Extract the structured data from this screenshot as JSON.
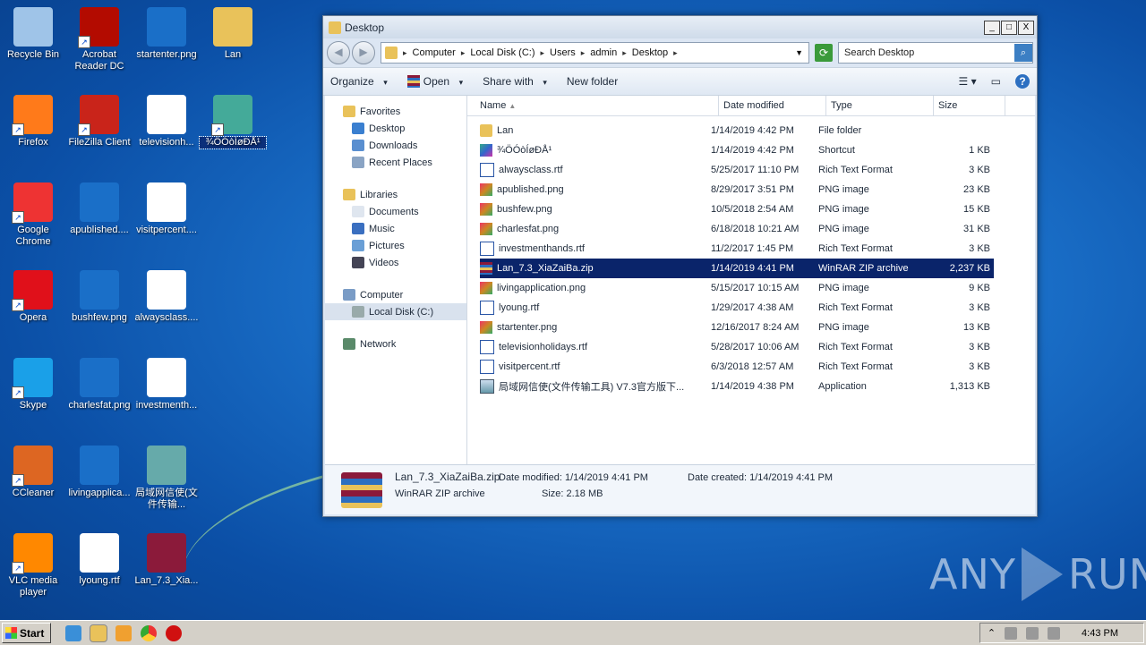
{
  "desktop": {
    "icons": [
      {
        "label": "Recycle Bin",
        "icon": "recycle-bin-icon",
        "color": "#9fc4e8"
      },
      {
        "label": "Acrobat Reader DC",
        "icon": "acrobat-icon",
        "color": "#b30b00"
      },
      {
        "label": "startenter.png",
        "icon": "png-file-icon",
        "color": "#1a6fc8"
      },
      {
        "label": "Lan",
        "icon": "folder-icon",
        "color": "#e9c25a"
      },
      {
        "label": "Firefox",
        "icon": "firefox-icon",
        "color": "#ff7a1a"
      },
      {
        "label": "FileZilla Client",
        "icon": "filezilla-icon",
        "color": "#c9241a"
      },
      {
        "label": "televisionh...",
        "icon": "word-doc-icon",
        "color": "#ffffff"
      },
      {
        "label": "¾ÖÓòÍøÐÅ¹",
        "icon": "shortcut-app-icon",
        "color": "#4a9"
      },
      {
        "label": "Google Chrome",
        "icon": "chrome-icon",
        "color": "#e33"
      },
      {
        "label": "apublished....",
        "icon": "png-file-icon",
        "color": "#1a6fc8"
      },
      {
        "label": "visitpercent....",
        "icon": "word-doc-icon",
        "color": "#ffffff"
      },
      {
        "label": "Opera",
        "icon": "opera-icon",
        "color": "#e0101a"
      },
      {
        "label": "bushfew.png",
        "icon": "png-file-icon",
        "color": "#1a6fc8"
      },
      {
        "label": "alwaysclass....",
        "icon": "word-doc-icon",
        "color": "#ffffff"
      },
      {
        "label": "Skype",
        "icon": "skype-icon",
        "color": "#1aa0e8"
      },
      {
        "label": "charlesfat.png",
        "icon": "png-file-icon",
        "color": "#1a6fc8"
      },
      {
        "label": "investmenth...",
        "icon": "word-doc-icon",
        "color": "#ffffff"
      },
      {
        "label": "CCleaner",
        "icon": "ccleaner-icon",
        "color": "#d62"
      },
      {
        "label": "livingapplica...",
        "icon": "png-file-icon",
        "color": "#1a6fc8"
      },
      {
        "label": "局域网信使(文件传输...",
        "icon": "installer-icon",
        "color": "#6aa"
      },
      {
        "label": "VLC media player",
        "icon": "vlc-icon",
        "color": "#f80"
      },
      {
        "label": "lyoung.rtf",
        "icon": "word-doc-icon",
        "color": "#ffffff"
      },
      {
        "label": "Lan_7.3_Xia...",
        "icon": "winrar-icon",
        "color": "#8b1a3a"
      }
    ]
  },
  "explorer": {
    "title": "Desktop",
    "title_buttons": [
      "_",
      "□",
      "X"
    ],
    "breadcrumb": [
      "Computer",
      "Local Disk (C:)",
      "Users",
      "admin",
      "Desktop"
    ],
    "search_placeholder": "Search Desktop",
    "toolbar": {
      "organize": "Organize",
      "open": "Open",
      "share": "Share with",
      "new_folder": "New folder"
    },
    "nav": {
      "favorites": "Favorites",
      "fav_items": [
        "Desktop",
        "Downloads",
        "Recent Places"
      ],
      "libraries": "Libraries",
      "lib_items": [
        "Documents",
        "Music",
        "Pictures",
        "Videos"
      ],
      "computer": "Computer",
      "local_disk": "Local Disk (C:)",
      "network": "Network"
    },
    "columns": [
      "Name",
      "Date modified",
      "Type",
      "Size"
    ],
    "files": [
      {
        "name": "Lan",
        "date": "1/14/2019 4:42 PM",
        "type": "File folder",
        "size": "",
        "icon": "i-folder"
      },
      {
        "name": "¾ÖÓòÍøÐÅ¹",
        "date": "1/14/2019 4:42 PM",
        "type": "Shortcut",
        "size": "1 KB",
        "icon": "i-shortcut"
      },
      {
        "name": "alwaysclass.rtf",
        "date": "5/25/2017 11:10 PM",
        "type": "Rich Text Format",
        "size": "3 KB",
        "icon": "i-rtf"
      },
      {
        "name": "apublished.png",
        "date": "8/29/2017 3:51 PM",
        "type": "PNG image",
        "size": "23 KB",
        "icon": "i-png"
      },
      {
        "name": "bushfew.png",
        "date": "10/5/2018 2:54 AM",
        "type": "PNG image",
        "size": "15 KB",
        "icon": "i-png"
      },
      {
        "name": "charlesfat.png",
        "date": "6/18/2018 10:21 AM",
        "type": "PNG image",
        "size": "31 KB",
        "icon": "i-png"
      },
      {
        "name": "investmenthands.rtf",
        "date": "11/2/2017 1:45 PM",
        "type": "Rich Text Format",
        "size": "3 KB",
        "icon": "i-rtf"
      },
      {
        "name": "Lan_7.3_XiaZaiBa.zip",
        "date": "1/14/2019 4:41 PM",
        "type": "WinRAR ZIP archive",
        "size": "2,237 KB",
        "icon": "i-zip",
        "selected": true
      },
      {
        "name": "livingapplication.png",
        "date": "5/15/2017 10:15 AM",
        "type": "PNG image",
        "size": "9 KB",
        "icon": "i-png"
      },
      {
        "name": "lyoung.rtf",
        "date": "1/29/2017 4:38 AM",
        "type": "Rich Text Format",
        "size": "3 KB",
        "icon": "i-rtf"
      },
      {
        "name": "startenter.png",
        "date": "12/16/2017 8:24 AM",
        "type": "PNG image",
        "size": "13 KB",
        "icon": "i-png"
      },
      {
        "name": "televisionholidays.rtf",
        "date": "5/28/2017 10:06 AM",
        "type": "Rich Text Format",
        "size": "3 KB",
        "icon": "i-rtf"
      },
      {
        "name": "visitpercent.rtf",
        "date": "6/3/2018 12:57 AM",
        "type": "Rich Text Format",
        "size": "3 KB",
        "icon": "i-rtf"
      },
      {
        "name": "局域网信使(文件传输工具) V7.3官方版下...",
        "date": "1/14/2019 4:38 PM",
        "type": "Application",
        "size": "1,313 KB",
        "icon": "i-app"
      }
    ],
    "details": {
      "name": "Lan_7.3_XiaZaiBa.zip",
      "modified": "Date modified: 1/14/2019 4:41 PM",
      "created": "Date created: 1/14/2019 4:41 PM",
      "type": "WinRAR ZIP archive",
      "size": "Size: 2.18 MB"
    }
  },
  "taskbar": {
    "start": "Start",
    "clock": "4:43 PM"
  },
  "watermark": {
    "left": "ANY",
    "right": "RUN"
  }
}
